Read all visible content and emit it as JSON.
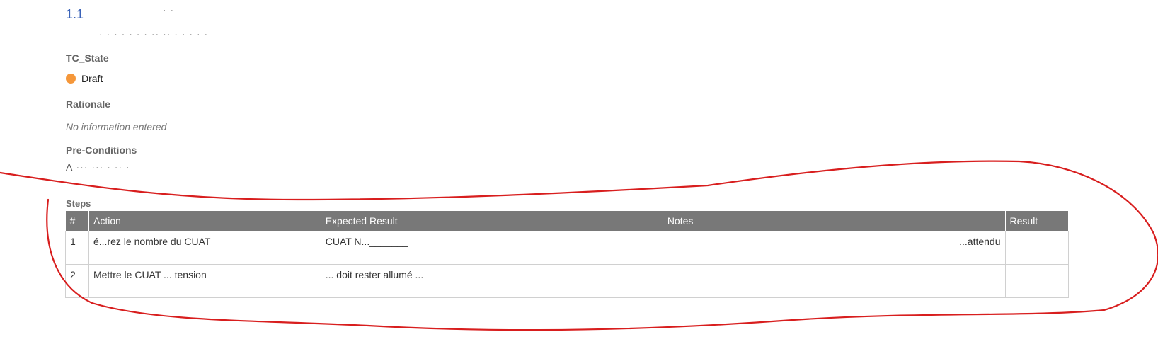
{
  "header": {
    "section_number": "1.1"
  },
  "tc_state": {
    "label": "TC_State",
    "value": "Draft",
    "status_color": "#f5973a"
  },
  "rationale": {
    "label": "Rationale",
    "value": "No information entered"
  },
  "pre_conditions": {
    "label": "Pre-Conditions"
  },
  "steps": {
    "label": "Steps",
    "columns": [
      "#",
      "Action",
      "Expected Result",
      "Notes",
      "Result"
    ],
    "rows": [
      {
        "num": "1",
        "action": "é...rez le nombre du CUAT",
        "expected": "CUAT N..._______",
        "notes": "...attendu",
        "result": ""
      },
      {
        "num": "2",
        "action": "Mettre le CUAT ... tension",
        "expected": "... doit rester allumé ...",
        "notes": "",
        "result": ""
      }
    ]
  },
  "colors": {
    "table_header_bg": "#787878",
    "link_blue": "#3b63b8",
    "annotation_red": "#d81e1e"
  }
}
